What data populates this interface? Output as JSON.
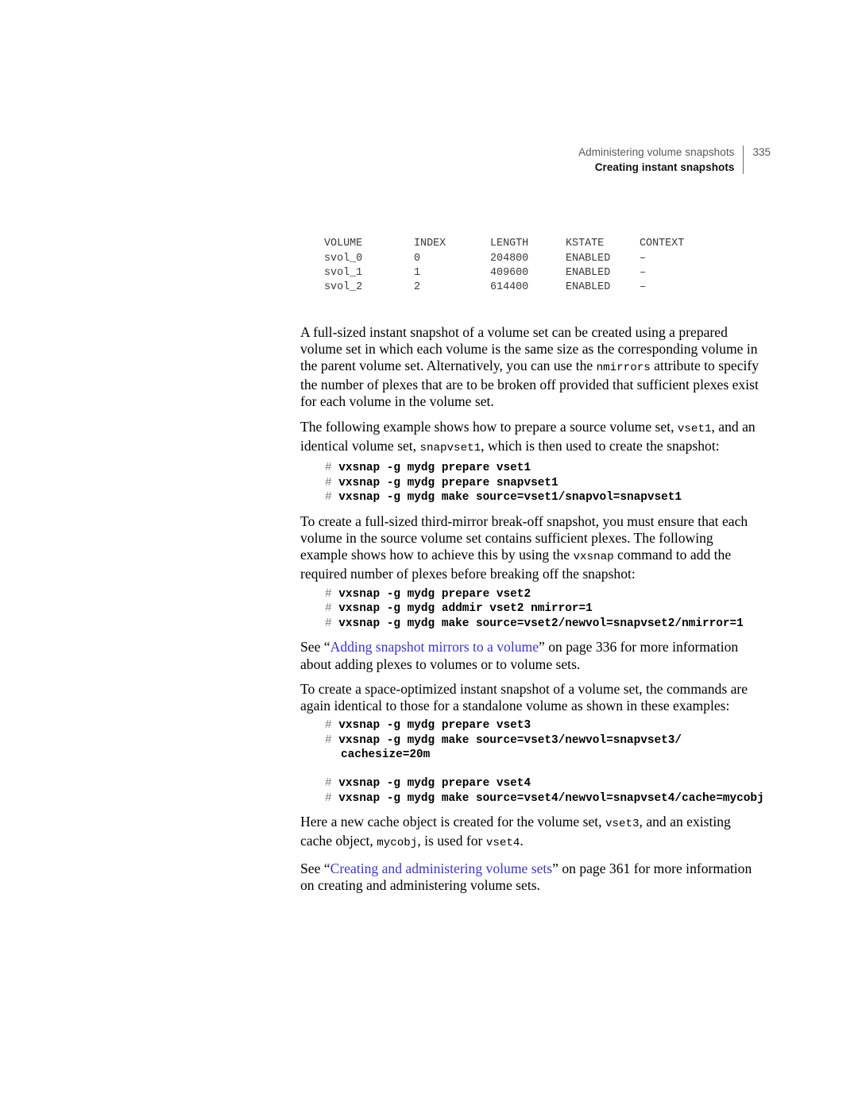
{
  "header": {
    "book_section": "Administering volume snapshots",
    "chapter_section": "Creating instant snapshots",
    "page_number": "335"
  },
  "cli_output": {
    "columns": [
      "VOLUME",
      "INDEX",
      "LENGTH",
      "KSTATE",
      "CONTEXT"
    ],
    "rows": [
      [
        "svol_0",
        "0",
        "204800",
        "ENABLED",
        "–"
      ],
      [
        "svol_1",
        "1",
        "409600",
        "ENABLED",
        "–"
      ],
      [
        "svol_2",
        "2",
        "614400",
        "ENABLED",
        "–"
      ]
    ]
  },
  "paragraphs": {
    "p1_a": "A full-sized instant snapshot of a volume set can be created using a prepared volume set in which each volume is the same size as the corresponding volume in the parent volume set. Alternatively, you can use the ",
    "p1_code": "nmirrors",
    "p1_b": " attribute to specify the number of plexes that are to be broken off provided that sufficient plexes exist for each volume in the volume set.",
    "p2_a": "The following example shows how to prepare a source volume set, ",
    "p2_code1": "vset1",
    "p2_b": ", and an identical volume set, ",
    "p2_code2": "snapvset1",
    "p2_c": ", which is then used to create the snapshot:",
    "p3_a": "To create a full-sized third-mirror break-off snapshot, you must ensure that each volume in the source volume set contains sufficient plexes. The following example shows how to achieve this by using the ",
    "p3_code": "vxsnap",
    "p3_b": " command to add the required number of plexes before breaking off the snapshot:",
    "p4_see": "See “",
    "p4_link": "Adding snapshot mirrors to a volume",
    "p4_after": "” on page 336 for more information about adding plexes to volumes or to volume sets.",
    "p5": "To create a space-optimized instant snapshot of a volume set, the commands are again identical to those for a standalone volume as shown in these examples:",
    "p6_a": "Here a new cache object is created for the volume set, ",
    "p6_code1": "vset3",
    "p6_b": ", and an existing cache object, ",
    "p6_code2": "mycobj",
    "p6_c": ", is used for ",
    "p6_code3": "vset4",
    "p6_d": ".",
    "p7_see": "See “",
    "p7_link": "Creating and administering volume sets",
    "p7_after": "” on page 361 for more information on creating and administering volume sets."
  },
  "commands": {
    "prompt": "# ",
    "block1": [
      "vxsnap -g mydg prepare vset1",
      "vxsnap -g mydg prepare snapvset1",
      "vxsnap -g mydg make source=vset1/snapvol=snapvset1"
    ],
    "block2": [
      "vxsnap -g mydg prepare vset2",
      "vxsnap -g mydg addmir vset2 nmirror=1",
      "vxsnap -g mydg make source=vset2/newvol=snapvset2/nmirror=1"
    ],
    "block3_line1": "vxsnap -g mydg prepare vset3",
    "block3_line2": "vxsnap -g mydg make source=vset3/newvol=snapvset3/",
    "block3_line2_cont": "cachesize=20m",
    "block4": [
      "vxsnap -g mydg prepare vset4",
      "vxsnap -g mydg make source=vset4/newvol=snapvset4/cache=mycobj"
    ]
  },
  "colors": {
    "link": "#3a35c8",
    "header_gray": "#58585a",
    "prompt_gray": "#777777",
    "cli_output": "#3a3a3a"
  }
}
